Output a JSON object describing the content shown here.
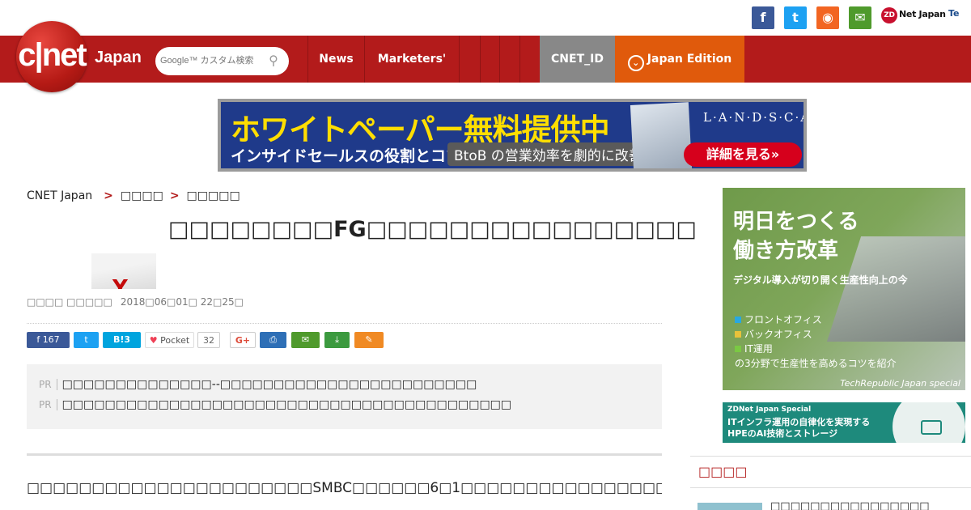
{
  "header": {
    "logo_text": "c|net",
    "logo_edition": "Japan",
    "search_placeholder": "Google™ カスタム検索",
    "social_icons": [
      "facebook-icon",
      "twitter-icon",
      "rss-icon",
      "mail-icon"
    ],
    "social_glyphs": {
      "facebook": "f",
      "twitter": "t",
      "rss": "◉",
      "mail": "✉"
    },
    "zdnet": {
      "badge": "ZD",
      "label": "Net Japan"
    },
    "techrepublic": "Te",
    "nav": {
      "news": "News",
      "marketers": "Marketers'",
      "blank1": "",
      "blank2": "",
      "blank3": "",
      "blank4": "",
      "cnet_id": "CNET_ID",
      "edition": "Japan Edition",
      "edition_glyph": "⌄"
    },
    "colors": {
      "brand_red": "#b31b1b",
      "edition_orange": "#e05a0c",
      "cnet_id_gray": "#888888"
    }
  },
  "banner_ad": {
    "headline": "ホワイトペーパー無料提供中",
    "sub": "インサイドセールスの役割とコツ",
    "pill": "BtoB の営業効率を劇的に改善！",
    "brand": "L·A·N·D·S·C·A·P·E",
    "cta": "詳細を見る»"
  },
  "breadcrumb": {
    "home": "CNET Japan",
    "sep": ">",
    "level1": "□□□□",
    "level2": "□□□□□"
  },
  "article": {
    "title": "□□□□□□□□FG□□□□□□□□□□□□□□□□",
    "byline": "□□□□ □□□□□",
    "date": "2018□06□01□ 22□25□",
    "share": {
      "facebook_count": "167",
      "hatena_label": "B!",
      "hatena_count": "3",
      "pocket_label": "Pocket",
      "pocket_count": "32",
      "gplus_label": "G+",
      "icons": {
        "print": "⎙",
        "mail": "✉",
        "download": "⤓",
        "clip": "✎"
      }
    },
    "pr": [
      {
        "tag": "PR",
        "text": "□□□□□□□□□□□□□□--□□□□□□□□□□□□□□□□□□□□□□□□"
      },
      {
        "tag": "PR",
        "text": "□□□□□□□□□□□□□□□□□□□□□□□□□□□□□□□□□□□□□□□□□□"
      }
    ],
    "body": "□□□□□□□□□□□□□□□□□□□□□□SMBC□□□□□□6□1□□□□□□□□□□□□□□□□□□□□□□□□□□□□□□□□□"
  },
  "sidebar": {
    "ad1": {
      "headline_1": "明日をつくる",
      "headline_2": "働き方改革",
      "sub": "デジタル導入が切り開く生産性向上の今",
      "items": [
        "フロントオフィス",
        "バックオフィス",
        "IT運用",
        "の3分野で生産性を高めるコツを紹介"
      ],
      "item_colors": [
        "#29a8e0",
        "#e8c23a",
        "#7ac943"
      ],
      "footer": "TechRepublic Japan special"
    },
    "ad2": {
      "label": "ZDNet Japan Special",
      "line1": "ITインフラ運用の自律化を実現する",
      "line2": "HPEのAI技術とストレージ"
    },
    "section_title": "□□□□",
    "first_item": "□□□□□□□□□□□□□□□□"
  }
}
